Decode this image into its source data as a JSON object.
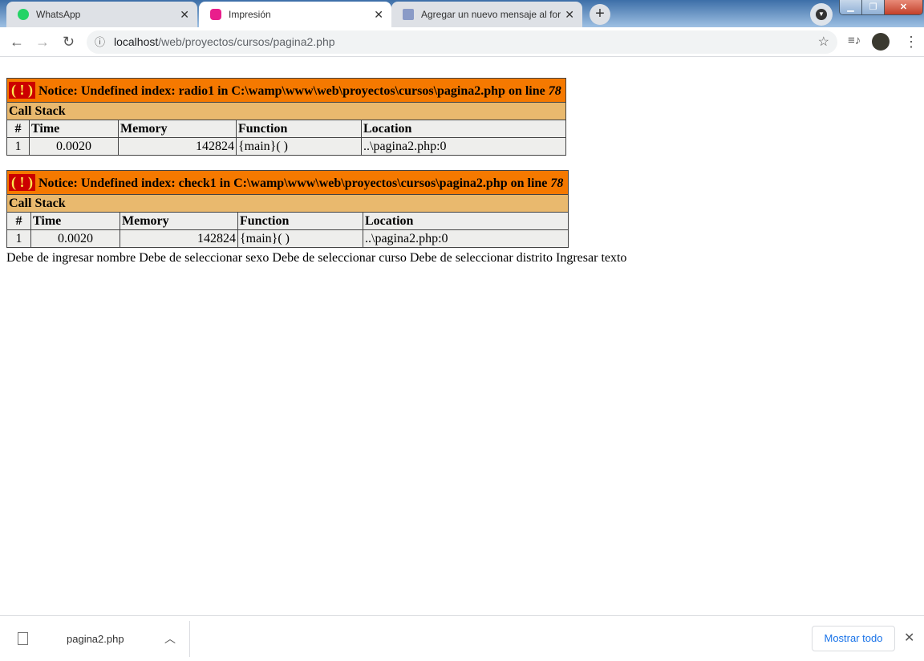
{
  "tabs": [
    {
      "title": "WhatsApp",
      "icon": "whatsapp-icon",
      "color": "#25d366"
    },
    {
      "title": "Impresión",
      "icon": "wamp-icon",
      "color": "#e91e8c"
    },
    {
      "title": "Agregar un nuevo mensaje al for",
      "icon": "braces-icon",
      "color": "#8a9bc7"
    }
  ],
  "address": {
    "host": "localhost",
    "path": "/web/proyectos/cursos/pagina2.php"
  },
  "errors": [
    {
      "bang": "( ! )",
      "notice": "Notice: Undefined index: radio1 in C:\\wamp\\www\\web\\proyectos\\cursos\\pagina2.php on line ",
      "line": "78",
      "call_stack": "Call Stack",
      "headers": [
        "#",
        "Time",
        "Memory",
        "Function",
        "Location"
      ],
      "row": [
        "1",
        "0.0020",
        "142824",
        "{main}( )",
        "..\\pagina2.php:0"
      ]
    },
    {
      "bang": "( ! )",
      "notice": "Notice: Undefined index: check1 in C:\\wamp\\www\\web\\proyectos\\cursos\\pagina2.php on line ",
      "line": "78",
      "call_stack": "Call Stack",
      "headers": [
        "#",
        "Time",
        "Memory",
        "Function",
        "Location"
      ],
      "row": [
        "1",
        "0.0020",
        "142824",
        "{main}( )",
        "..\\pagina2.php:0"
      ]
    }
  ],
  "message": "Debe de ingresar nombre Debe de seleccionar sexo Debe de seleccionar curso Debe de seleccionar distrito Ingresar texto",
  "download": {
    "filename": "pagina2.php",
    "show_all": "Mostrar todo"
  }
}
